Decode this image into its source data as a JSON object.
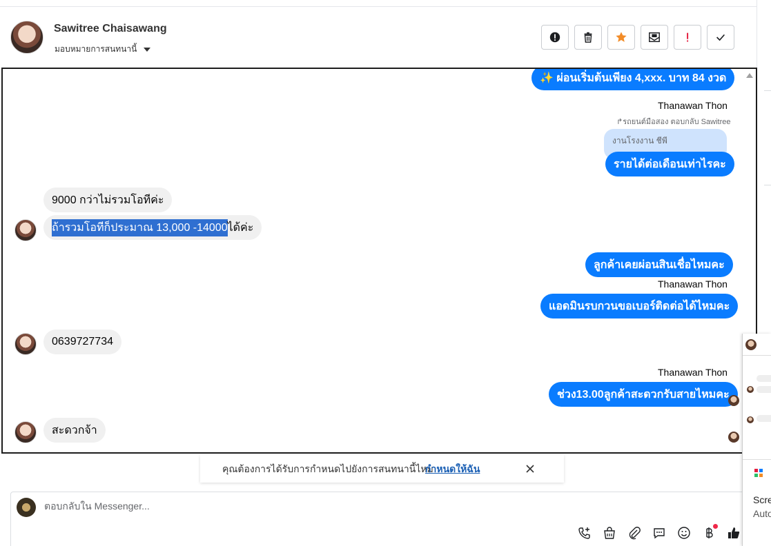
{
  "header": {
    "contact_name": "Sawitree Chaisawang",
    "assign_label": "มอบหมายการสนทนานี้",
    "actions": [
      {
        "name": "spam-button",
        "icon": "exclamation-circle-icon"
      },
      {
        "name": "delete-button",
        "icon": "trash-icon"
      },
      {
        "name": "star-button",
        "icon": "star-icon",
        "color": "#f28c28"
      },
      {
        "name": "mark-unread-button",
        "icon": "envelope-icon"
      },
      {
        "name": "follow-up-button",
        "icon": "exclamation-icon",
        "color": "#e41e3f"
      },
      {
        "name": "mark-done-button",
        "icon": "check-icon"
      }
    ]
  },
  "messages": {
    "m1": "✨ ผ่อนเริ่มต้นเพียง 4,xxx. บาท 84 งวด",
    "sender1": "Thanawan Thon",
    "reply_meta": "รถยนต์มือสอง ตอบกลับ Sawitree",
    "quoted": "งานโรงงาน ชีพี",
    "m2": "รายได้ต่อเดือนเท่าไรคะ",
    "in1": "9000 กว่าไม่รวมโอทีค่ะ",
    "in2_highlight": "ถ้ารวมโอทีก็ประมาณ 13,000 -14000",
    "in2_rest": "ได้ค่ะ",
    "m3": "ลูกค้าเคยผ่อนสินเชื่อไหมคะ",
    "sender2": "Thanawan Thon",
    "m4": "แอดมินรบกวนขอเบอร์ติดต่อได้ไหมคะ",
    "in3": "0639727734",
    "sender3": "Thanawan Thon",
    "m5": "ช่วง13.00ลูกค้าสะดวกรับสายไหมคะ",
    "in4": "สะดวกจ้า"
  },
  "toast": {
    "text": "คุณต้องการได้รับการกำหนดไปยังการสนทนานี้ไหม",
    "link": "กำหนดให้ฉัน"
  },
  "composer": {
    "placeholder": "ตอบกลับใน Messenger..."
  },
  "side_panel": {
    "word1": "Scre",
    "word2": "Auto"
  },
  "colors": {
    "outgoing_bubble": "#0a7cff",
    "incoming_bubble": "#f0f0f0",
    "quoted_bubble": "#cfe3fd",
    "highlight": "#2f6fd1"
  }
}
